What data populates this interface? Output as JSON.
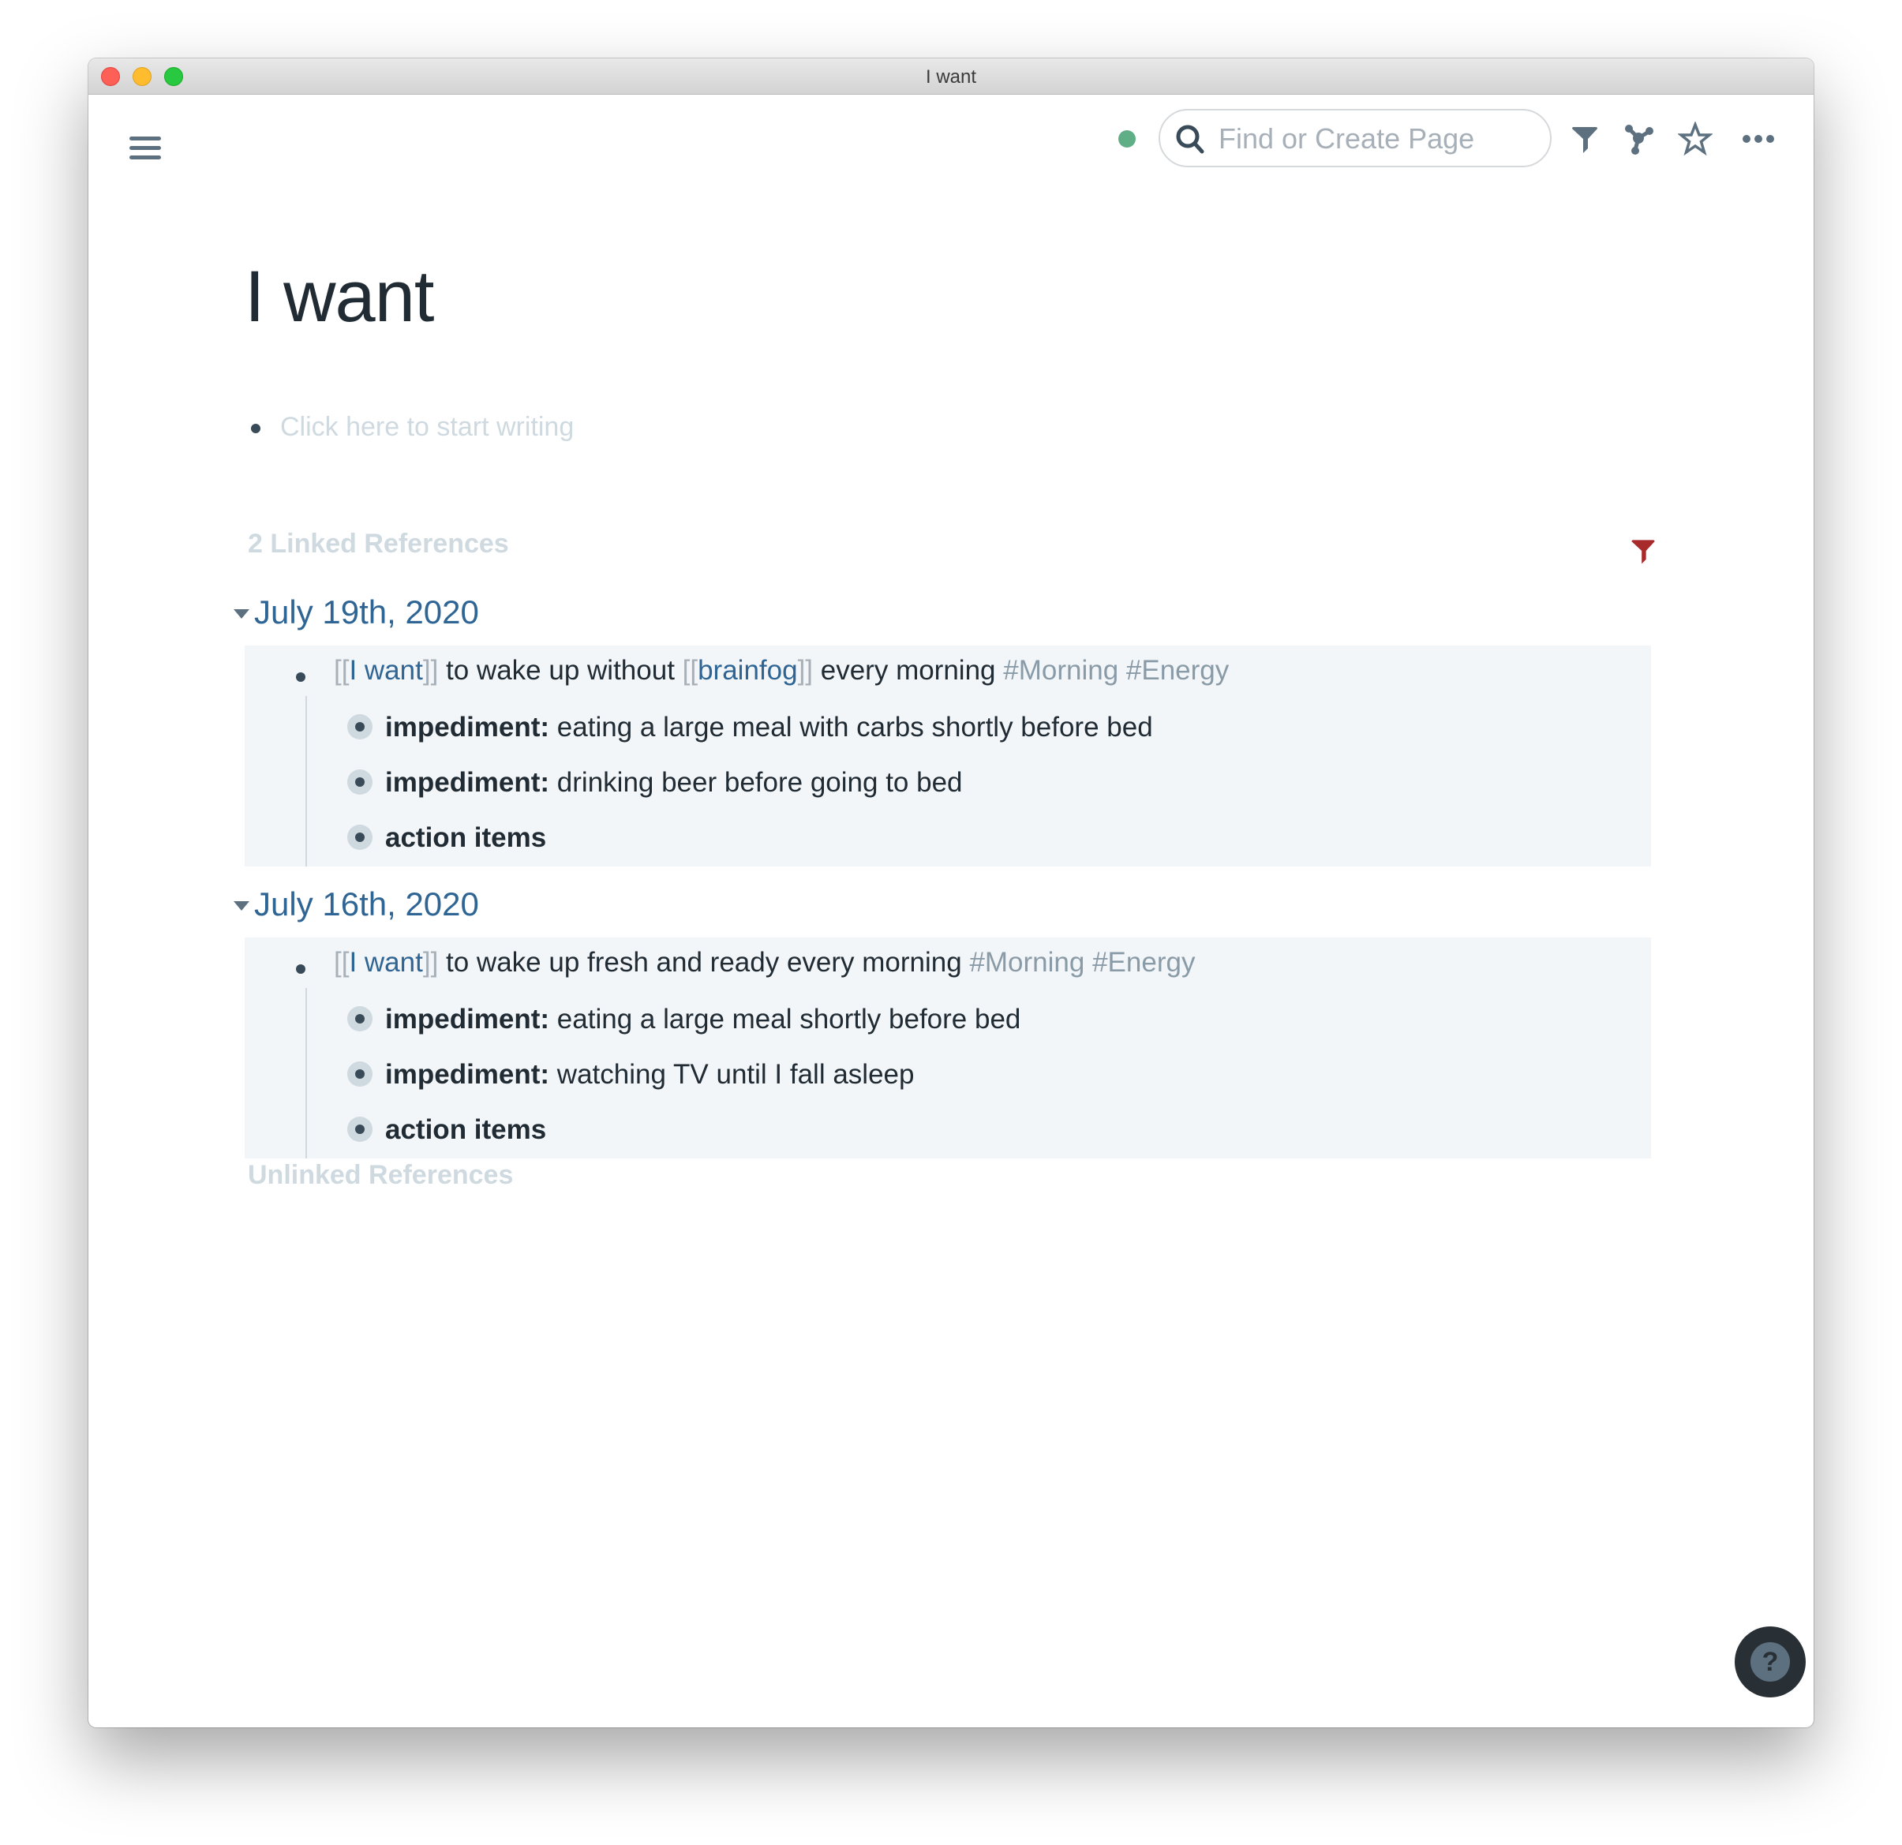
{
  "window": {
    "title": "I want"
  },
  "toolbar": {
    "menu_icon": "hamburger-menu-icon",
    "sync_status": "synced",
    "sync_color": "#5fae86",
    "search": {
      "placeholder": "Find or Create Page",
      "value": ""
    },
    "icons": [
      "filter-icon",
      "graph-icon",
      "star-icon",
      "more-icon"
    ]
  },
  "page": {
    "title": "I want",
    "placeholder": "Click here to start writing"
  },
  "linked_references": {
    "header": "2 Linked References",
    "filter_color": "#a82a2a",
    "groups": [
      {
        "date": "July 19th, 2020",
        "block": {
          "parts": [
            {
              "type": "bracket",
              "text": "[["
            },
            {
              "type": "ref",
              "text": "I want"
            },
            {
              "type": "bracket",
              "text": "]]"
            },
            {
              "type": "text",
              "text": " to wake up without "
            },
            {
              "type": "bracket",
              "text": "[["
            },
            {
              "type": "ref",
              "text": "brainfog"
            },
            {
              "type": "bracket",
              "text": "]]"
            },
            {
              "type": "text",
              "text": " every morning "
            },
            {
              "type": "tag",
              "text": "#Morning"
            },
            {
              "type": "text",
              "text": " "
            },
            {
              "type": "tag",
              "text": "#Energy"
            }
          ],
          "children": [
            {
              "label": "impediment:",
              "text": " eating a large meal with carbs shortly before bed"
            },
            {
              "label": "impediment:",
              "text": " drinking beer before going to bed"
            },
            {
              "label": "action items",
              "text": ""
            }
          ]
        }
      },
      {
        "date": "July 16th, 2020",
        "block": {
          "parts": [
            {
              "type": "bracket",
              "text": "[["
            },
            {
              "type": "ref",
              "text": "I want"
            },
            {
              "type": "bracket",
              "text": "]]"
            },
            {
              "type": "text",
              "text": " to wake up fresh and ready every morning "
            },
            {
              "type": "tag",
              "text": "#Morning"
            },
            {
              "type": "text",
              "text": " "
            },
            {
              "type": "tag",
              "text": "#Energy"
            }
          ],
          "children": [
            {
              "label": "impediment:",
              "text": " eating a large meal shortly before bed"
            },
            {
              "label": "impediment:",
              "text": " watching TV until I fall asleep"
            },
            {
              "label": "action items",
              "text": ""
            }
          ]
        }
      }
    ]
  },
  "unlinked_references": {
    "header": "Unlinked References"
  },
  "help": {
    "label": "?"
  }
}
